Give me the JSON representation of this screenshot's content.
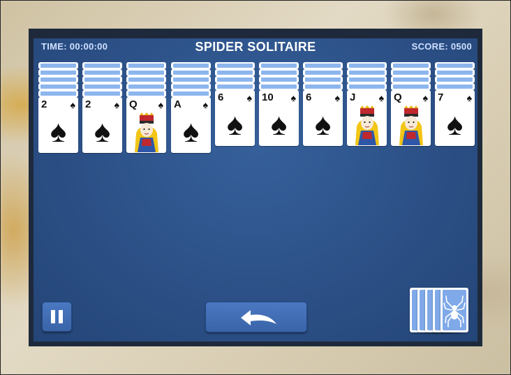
{
  "hud": {
    "time": "TIME: 00:00:00",
    "title": "SPIDER SOLITAIRE",
    "score": "SCORE: 0500"
  },
  "colors": {
    "felt": "#2b4f85",
    "card_back": "#8db6ee",
    "button": "#4a78c2"
  },
  "tableau": [
    {
      "rank": "2",
      "suit": "♠",
      "hidden": 5,
      "court": false
    },
    {
      "rank": "2",
      "suit": "♠",
      "hidden": 5,
      "court": false
    },
    {
      "rank": "Q",
      "suit": "♠",
      "hidden": 5,
      "court": true
    },
    {
      "rank": "A",
      "suit": "♠",
      "hidden": 5,
      "court": false
    },
    {
      "rank": "6",
      "suit": "♠",
      "hidden": 4,
      "court": false
    },
    {
      "rank": "10",
      "suit": "♠",
      "hidden": 4,
      "court": false
    },
    {
      "rank": "6",
      "suit": "♠",
      "hidden": 4,
      "court": false
    },
    {
      "rank": "J",
      "suit": "♠",
      "hidden": 4,
      "court": true
    },
    {
      "rank": "Q",
      "suit": "♠",
      "hidden": 4,
      "court": true
    },
    {
      "rank": "7",
      "suit": "♠",
      "hidden": 4,
      "court": false
    }
  ],
  "stock": {
    "deals_remaining": 5
  },
  "icons": {
    "pause": "pause-icon",
    "undo": "undo-arrow-icon",
    "stock": "spider-icon"
  }
}
